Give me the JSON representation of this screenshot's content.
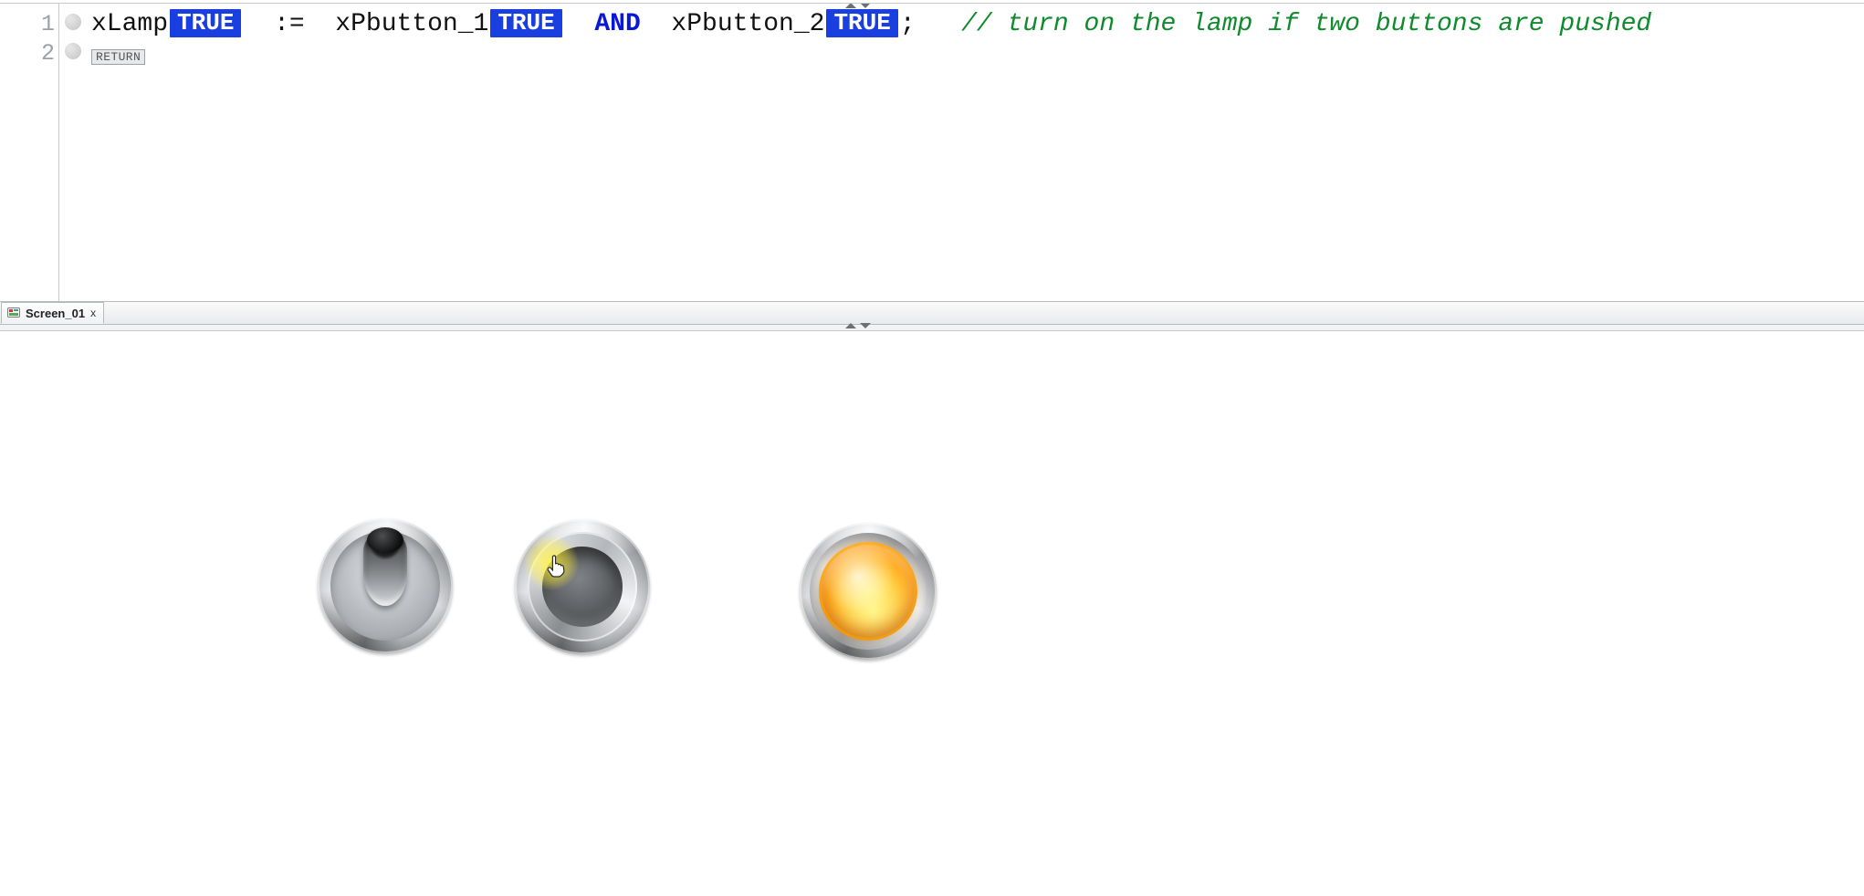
{
  "editor": {
    "lines": {
      "l1": {
        "num": "1"
      },
      "l2": {
        "num": "2"
      }
    },
    "code": {
      "var_lamp": "xLamp",
      "val_lamp": "TRUE",
      "assign_op": ":=",
      "var_btn1": "xPbutton_1",
      "val_btn1": "TRUE",
      "kw_and": "AND",
      "var_btn2": "xPbutton_2",
      "val_btn2": "TRUE",
      "semicolon": ";",
      "comment": "// turn on the lamp if two buttons are pushed",
      "return_badge": "RETURN"
    }
  },
  "tabs": {
    "screen01": {
      "label": "Screen_01",
      "close": "x"
    }
  },
  "vis": {
    "dipswitch": {
      "state": "on"
    },
    "pushbutton": {
      "state": "pressed"
    },
    "lamp": {
      "state": "on",
      "color": "#ffa400"
    }
  }
}
